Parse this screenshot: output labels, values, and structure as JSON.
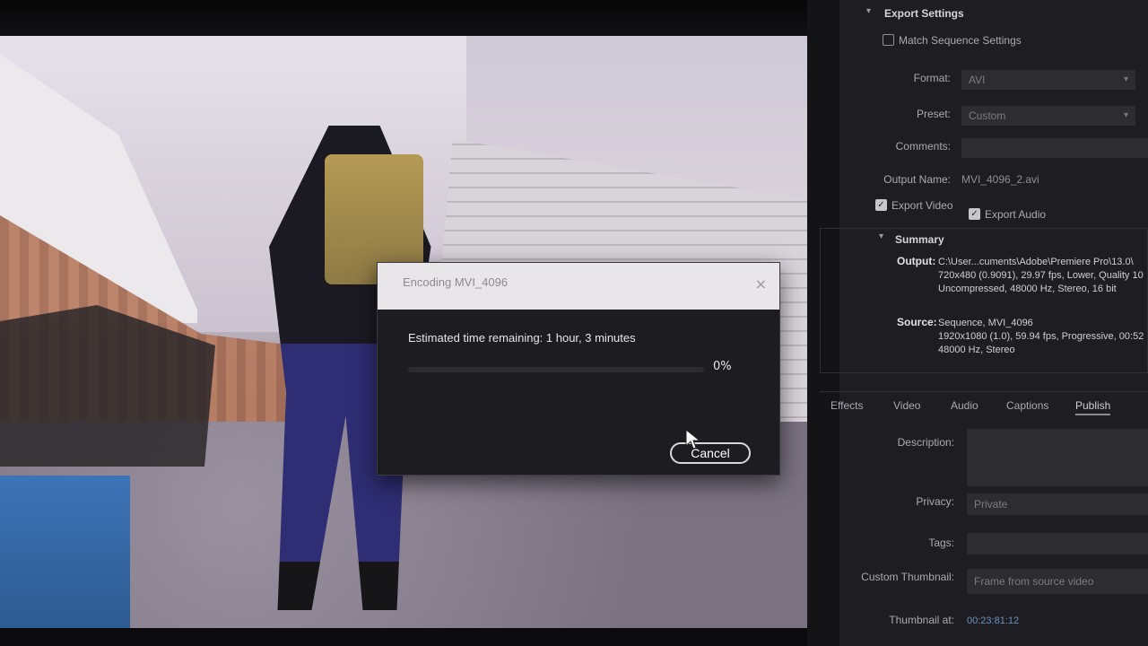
{
  "dialog": {
    "title": "Encoding MVI_4096",
    "close": "×",
    "estimate": "Estimated time remaining: 1 hour, 3 minutes",
    "progress": 0,
    "percent": "0%",
    "cancel": "Cancel"
  },
  "export_settings": {
    "title": "Export Settings",
    "match_sequence": "Match Sequence Settings",
    "format_label": "Format:",
    "format_value": "AVI",
    "preset_label": "Preset:",
    "preset_value": "Custom",
    "comments_label": "Comments:",
    "output_name_label": "Output Name:",
    "output_name_value": "MVI_4096_2.avi",
    "export_video": "Export Video",
    "export_audio": "Export Audio"
  },
  "summary": {
    "title": "Summary",
    "output_key": "Output:",
    "output_lines": [
      "C:\\User...cuments\\Adobe\\Premiere Pro\\13.0\\",
      "720x480 (0.9091), 29.97 fps, Lower, Quality 10",
      "Uncompressed, 48000 Hz, Stereo, 16 bit"
    ],
    "source_key": "Source:",
    "source_lines": [
      "Sequence, MVI_4096",
      "1920x1080 (1.0), 59.94 fps, Progressive, 00:52",
      "48000 Hz, Stereo"
    ]
  },
  "tabs": [
    "Effects",
    "Video",
    "Audio",
    "Captions",
    "Publish"
  ],
  "publish": {
    "description_label": "Description:",
    "privacy_label": "Privacy:",
    "privacy_value": "Private",
    "tags_label": "Tags:",
    "custom_thumbnail_label": "Custom Thumbnail:",
    "custom_thumbnail_value": "Frame from source video",
    "thumbnail_at_label": "Thumbnail at:",
    "thumbnail_at_value": "00:23:81:12"
  },
  "colors": {
    "accent": "#3d8de8",
    "panel_bg": "#1e1e22",
    "dialog_titlebar": "#e9e6ea"
  }
}
